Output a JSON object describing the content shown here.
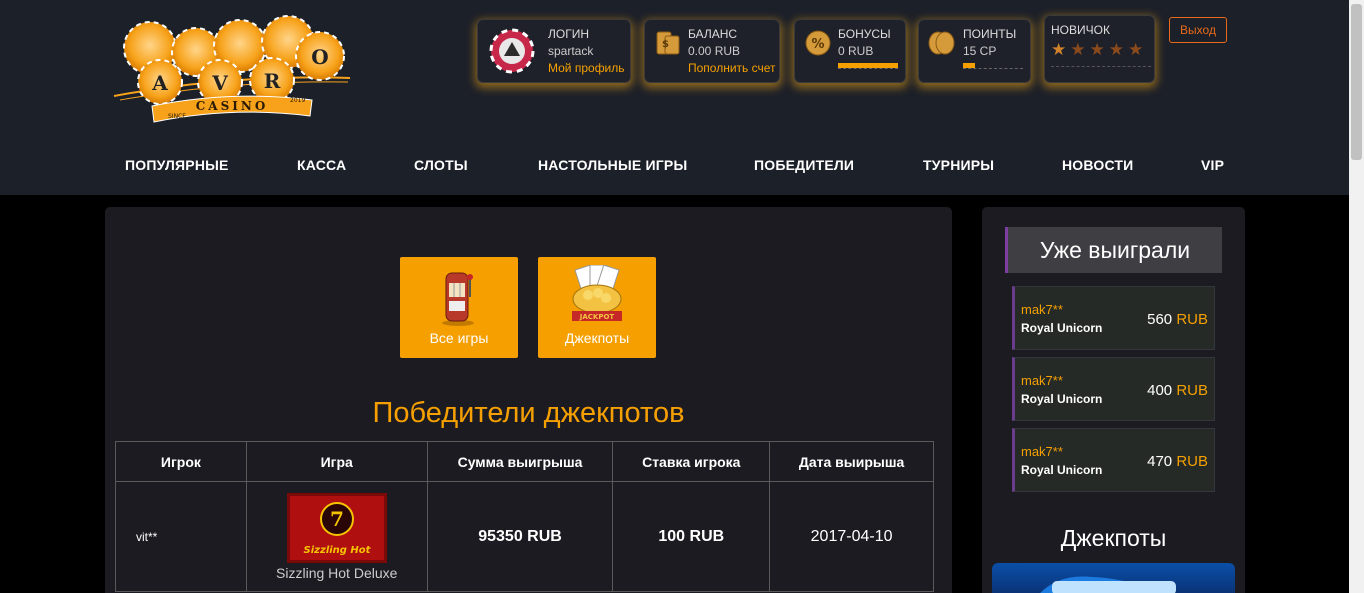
{
  "brand": {
    "logo_letters": [
      "A",
      "V",
      "R",
      "O"
    ],
    "logo_word": "CASINO",
    "since": "SINCE",
    "year": "2019"
  },
  "account": {
    "login": {
      "title": "ЛОГИН",
      "value": "spartack",
      "link": "Мой профиль"
    },
    "balance": {
      "title": "БАЛАНС",
      "value": "0.00 RUB",
      "link": "Пополнить счет"
    },
    "bonus": {
      "title": "БОНУСЫ",
      "value": "0 RUB",
      "progress": 1.0
    },
    "points": {
      "title": "ПОИНТЫ",
      "value": "15 CP",
      "progress": 0.2
    },
    "rank": {
      "title": "НОВИЧОК",
      "stars_total": 5,
      "stars_filled": 1
    },
    "exit": "Выход"
  },
  "nav": [
    "ПОПУЛЯРНЫЕ",
    "КАССА",
    "СЛОТЫ",
    "НАСТОЛЬНЫЕ ИГРЫ",
    "ПОБЕДИТЕЛИ",
    "ТУРНИРЫ",
    "НОВОСТИ",
    "VIP"
  ],
  "tiles": [
    {
      "label": "Все игры",
      "icon": "slot-machine-icon"
    },
    {
      "label": "Джекпоты",
      "icon": "jackpot-icon"
    }
  ],
  "jackpot_winners": {
    "heading": "Победители джекпотов",
    "columns": [
      "Игрок",
      "Игра",
      "Сумма выигрыша",
      "Ставка игрока",
      "Дата выирыша"
    ],
    "rows": [
      {
        "player": "vit**",
        "game": "Sizzling Hot Deluxe",
        "game_logo": "Sizzling Hot",
        "amount": "95350 RUB",
        "bet": "100 RUB",
        "date": "2017-04-10"
      }
    ]
  },
  "sidebar": {
    "title": "Уже выиграли",
    "winners": [
      {
        "name": "mak7**",
        "game": "Royal Unicorn",
        "amount": "560",
        "currency": "RUB"
      },
      {
        "name": "mak7**",
        "game": "Royal Unicorn",
        "amount": "400",
        "currency": "RUB"
      },
      {
        "name": "mak7**",
        "game": "Royal Unicorn",
        "amount": "470",
        "currency": "RUB"
      }
    ],
    "jackpots_title": "Джекпоты"
  },
  "colors": {
    "accent": "#f5a000",
    "header_bg": "#1c2029",
    "panel_bg": "#1c1b21",
    "exit": "#e86a1a",
    "card_border": "#6a3c8e"
  }
}
